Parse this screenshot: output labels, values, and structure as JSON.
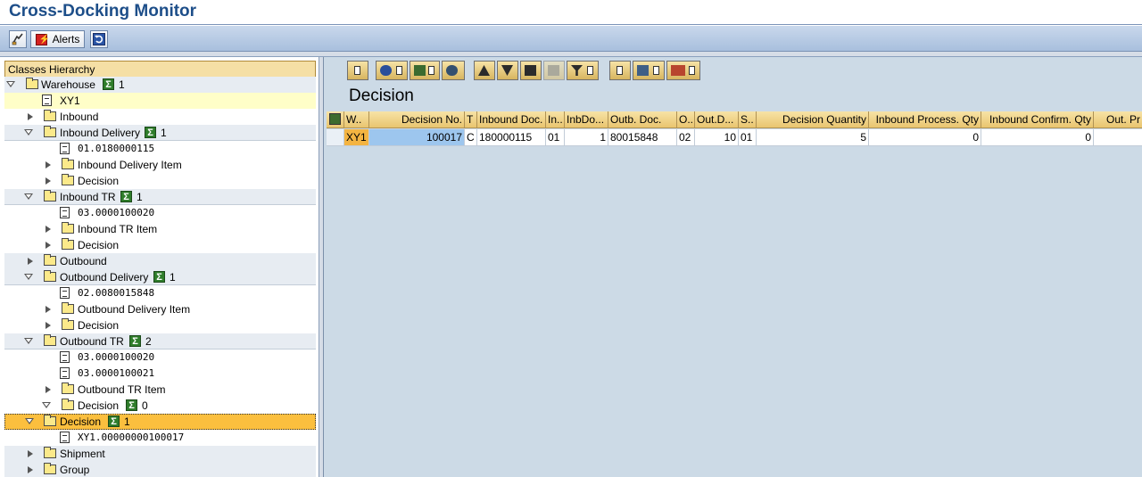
{
  "app": {
    "title": "Cross-Docking Monitor"
  },
  "toolbar": {
    "alerts_label": "Alerts",
    "icons": [
      "personalize-icon",
      "alert-icon",
      "refresh-icon"
    ]
  },
  "tree": {
    "header": "Classes Hierarchy",
    "rows": [
      {
        "label": "Warehouse",
        "count": "1"
      },
      {
        "label": "XY1"
      },
      {
        "label": "Inbound"
      },
      {
        "label": "Inbound Delivery",
        "count": "1"
      },
      {
        "label": "01.0180000115"
      },
      {
        "label": "Inbound Delivery Item"
      },
      {
        "label": "Decision"
      },
      {
        "label": "Inbound TR",
        "count": "1"
      },
      {
        "label": "03.0000100020"
      },
      {
        "label": "Inbound TR Item"
      },
      {
        "label": "Decision"
      },
      {
        "label": "Outbound"
      },
      {
        "label": "Outbound Delivery",
        "count": "1"
      },
      {
        "label": "02.0080015848"
      },
      {
        "label": "Outbound Delivery Item"
      },
      {
        "label": "Decision"
      },
      {
        "label": "Outbound TR",
        "count": "2"
      },
      {
        "label": "03.0000100020"
      },
      {
        "label": "03.0000100021"
      },
      {
        "label": "Outbound TR Item"
      },
      {
        "label": "Decision",
        "count": "0"
      },
      {
        "label": "Decision",
        "count": "1"
      },
      {
        "label": "XY1.00000000100017"
      },
      {
        "label": "Shipment"
      },
      {
        "label": "Group"
      }
    ]
  },
  "main": {
    "section_title": "Decision",
    "grid": {
      "headers": [
        "W..",
        "Decision No.",
        "T",
        "Inbound Doc.",
        "In..",
        "InbDo...",
        "Outb. Doc.",
        "O..",
        "Out.D...",
        "S..",
        "Decision Quantity",
        "Inbound Process. Qty",
        "Inbound Confirm. Qty",
        "Out. Pr"
      ],
      "rows": [
        [
          "XY1",
          "100017",
          "C",
          "180000115",
          "01",
          "1",
          "80015848",
          "02",
          "10",
          "01",
          "5",
          "0",
          "0",
          ""
        ]
      ]
    }
  }
}
